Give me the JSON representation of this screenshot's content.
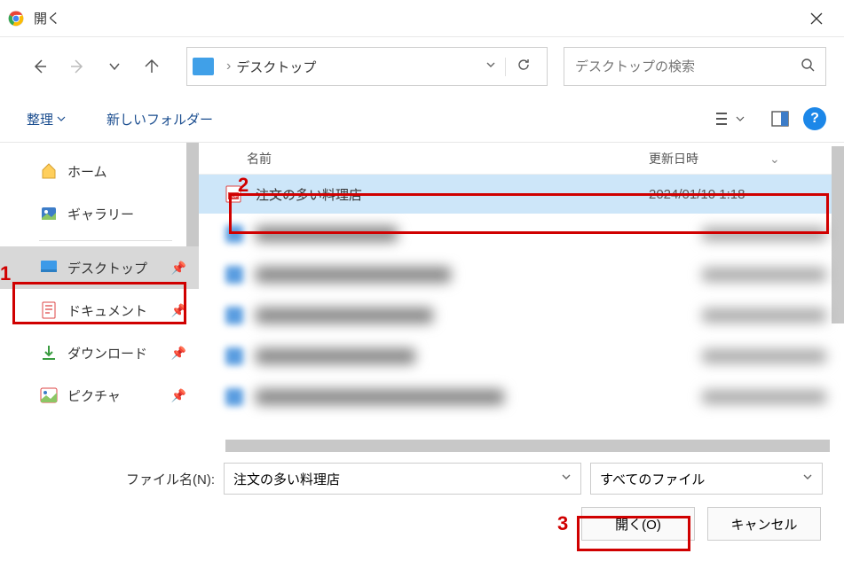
{
  "window": {
    "title": "開く"
  },
  "path": {
    "segment": "デスクトップ"
  },
  "search": {
    "placeholder": "デスクトップの検索"
  },
  "toolbar": {
    "organize": "整理",
    "newFolder": "新しいフォルダー"
  },
  "sidebar": {
    "home": "ホーム",
    "gallery": "ギャラリー",
    "desktop": "デスクトップ",
    "documents": "ドキュメント",
    "downloads": "ダウンロード",
    "pictures": "ピクチャ"
  },
  "columns": {
    "name": "名前",
    "date": "更新日時"
  },
  "file": {
    "name": "注文の多い料理店",
    "date": "2024/01/10 1:18"
  },
  "footer": {
    "filenameLabel": "ファイル名(N):",
    "filenameValue": "注文の多い料理店",
    "filter": "すべてのファイル",
    "open": "開く(O)",
    "cancel": "キャンセル"
  },
  "annotations": {
    "a1": "1",
    "a2": "2",
    "a3": "3"
  }
}
